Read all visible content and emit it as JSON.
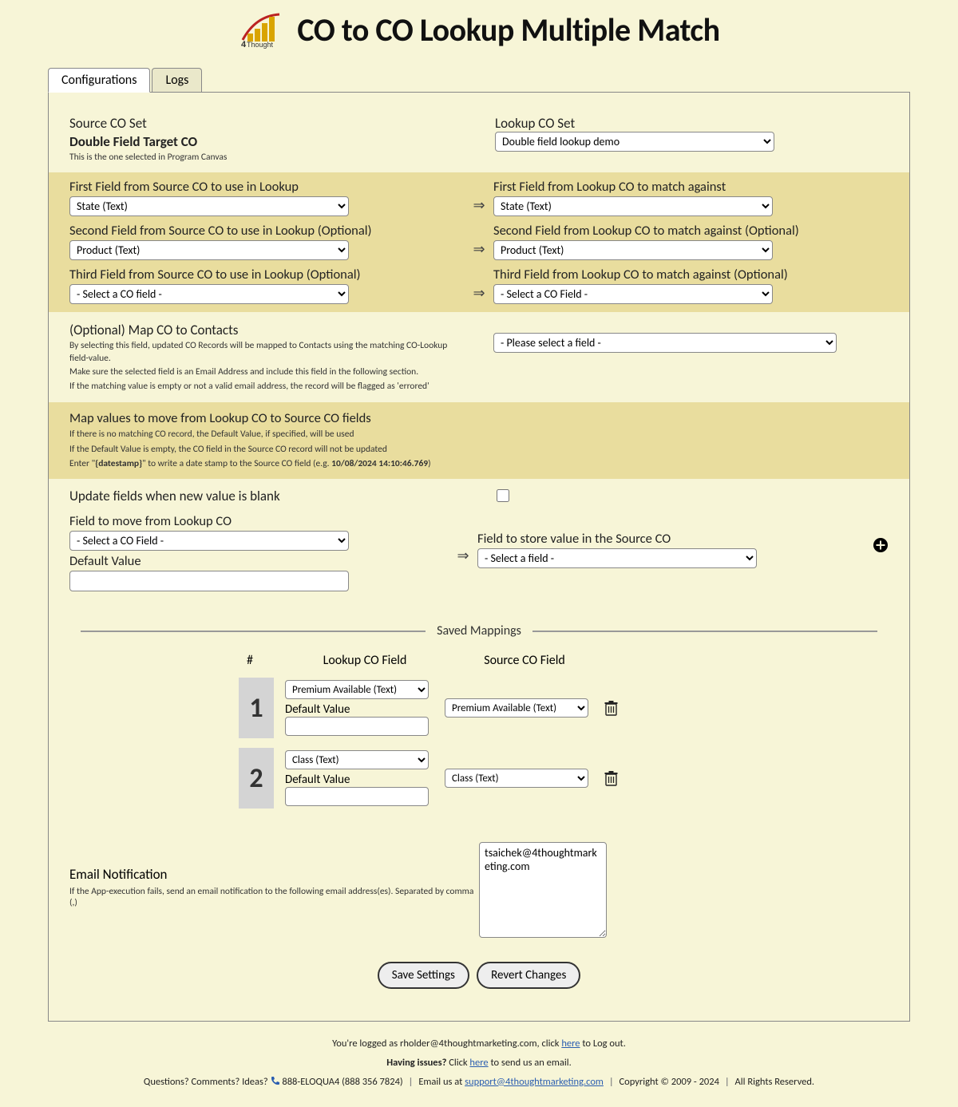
{
  "header": {
    "title": "CO to CO Lookup Multiple Match"
  },
  "tabs": {
    "configurations": "Configurations",
    "logs": "Logs"
  },
  "source": {
    "label": "Source CO Set",
    "name": "Double Field Target CO",
    "hint": "This is the one selected in Program Canvas"
  },
  "lookup": {
    "label": "Lookup CO Set",
    "selected": "Double field lookup demo"
  },
  "arrow_glyph": "⇒",
  "match_fields": {
    "src1_label": "First Field from Source CO to use in Lookup",
    "src1_value": "State (Text)",
    "dst1_label": "First Field from Lookup CO to match against",
    "dst1_value": "State (Text)",
    "src2_label": "Second Field from Source CO to use in Lookup (Optional)",
    "src2_value": "Product (Text)",
    "dst2_label": "Second Field from Lookup CO to match against (Optional)",
    "dst2_value": "Product (Text)",
    "src3_label": "Third Field from Source CO to use in Lookup (Optional)",
    "src3_value": "- Select a CO field -",
    "dst3_label": "Third Field from Lookup CO to match against (Optional)",
    "dst3_value": "- Select a CO Field -"
  },
  "map_contacts": {
    "title": "(Optional) Map CO to Contacts",
    "desc1": "By selecting this field, updated CO Records will be mapped to Contacts using the matching CO-Lookup field-value.",
    "desc2": "Make sure the selected field is an Email Address and include this field in the following section.",
    "desc3": "If the matching value is empty or not a valid email address, the record will be flagged as 'errored'",
    "value": "- Please select a field -"
  },
  "map_values": {
    "title": "Map values to move from Lookup CO to Source CO fields",
    "l1": "If there is no matching CO record, the Default Value, if specified, will be used",
    "l2": "If the Default Value is empty, the CO field in the Source CO record will not be updated",
    "l3_prefix": "Enter \"",
    "l3_token": "{datestamp}",
    "l3_mid": "\" to write a date stamp to the Source CO field (e.g. ",
    "l3_stamp": "10/08/2024 14:10:46.769",
    "l3_suffix": ")"
  },
  "update_blank": {
    "label": "Update fields when new value is blank",
    "checked": false
  },
  "field_move": {
    "src_label": "Field to move from Lookup CO",
    "src_value": "- Select a CO Field -",
    "default_label": "Default Value",
    "default_value": "",
    "dst_label": "Field to store value in the Source CO",
    "dst_value": "- Select a field -"
  },
  "divider_label": "Saved Mappings",
  "mappings_head": {
    "num": "#",
    "lookup": "Lookup CO Field",
    "source": "Source CO Field"
  },
  "mappings": [
    {
      "num": "1",
      "lookup": "Premium Available (Text)",
      "default_label": "Default Value",
      "default_value": "",
      "source": "Premium Available (Text)"
    },
    {
      "num": "2",
      "lookup": "Class (Text)",
      "default_label": "Default Value",
      "default_value": "",
      "source": "Class (Text)"
    }
  ],
  "email": {
    "title": "Email Notification",
    "desc": "If the App-execution fails, send an email notification to the following email address(es). Separated by comma (,)",
    "value": "tsaichek@4thoughtmarketing.com"
  },
  "buttons": {
    "save": "Save Settings",
    "revert": "Revert Changes"
  },
  "footer": {
    "logged_prefix": "You're logged as rholder@4thoughtmarketing.com, click ",
    "logged_link": "here",
    "logged_suffix": " to Log out.",
    "issues_prefix": "Having issues?",
    "issues_mid": " Click ",
    "issues_link": "here",
    "issues_suffix": " to send us an email.",
    "contact_prefix": "Questions? Comments? Ideas? ",
    "phone": "888-ELOQUA4 (888 356 7824)",
    "email_prefix": "Email us at ",
    "email_link": "support@4thoughtmarketing.com",
    "copyright": "Copyright © 2009 - 2024",
    "rights": "All Rights Reserved."
  }
}
